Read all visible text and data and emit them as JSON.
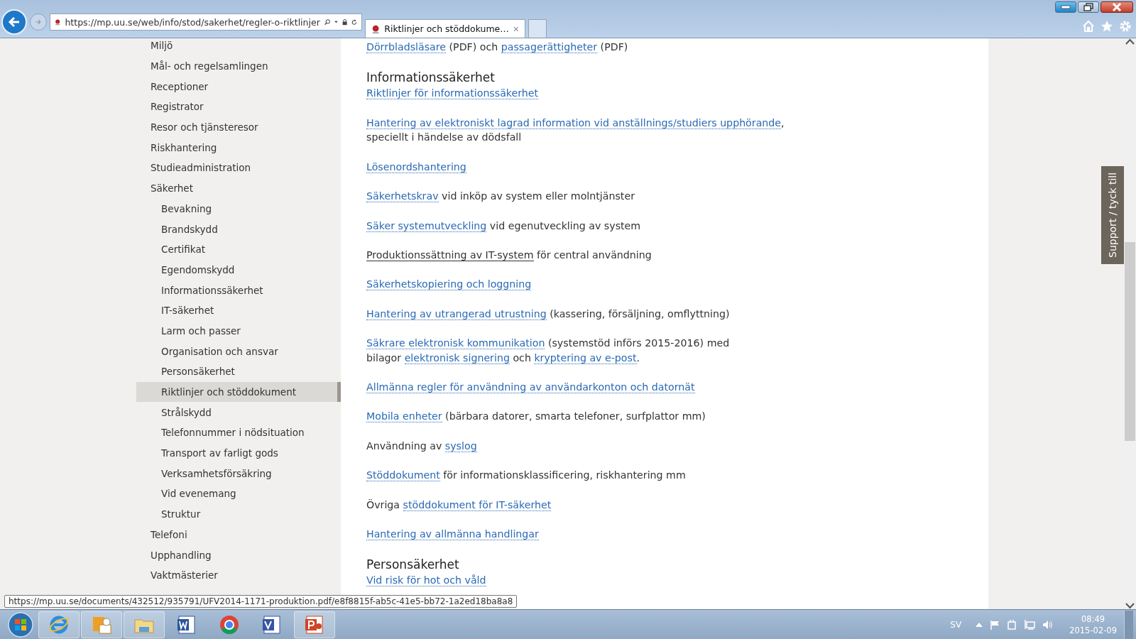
{
  "browser": {
    "address": "https://mp.uu.se/web/info/stod/sakerhet/regler-o-riktlinjer",
    "tab_title": "Riktlinjer och stöddokume…",
    "tab_close": "×"
  },
  "sidebar": {
    "items": [
      {
        "label": "Miljö",
        "selected": false
      },
      {
        "label": "Mål- och regelsamlingen",
        "selected": false
      },
      {
        "label": "Receptioner",
        "selected": false
      },
      {
        "label": "Registrator",
        "selected": false
      },
      {
        "label": "Resor och tjänsteresor",
        "selected": false
      },
      {
        "label": "Riskhantering",
        "selected": false
      },
      {
        "label": "Studieadministration",
        "selected": false
      },
      {
        "label": "Säkerhet",
        "selected": false,
        "children": [
          {
            "label": "Bevakning",
            "selected": false
          },
          {
            "label": "Brandskydd",
            "selected": false
          },
          {
            "label": "Certifikat",
            "selected": false
          },
          {
            "label": "Egendomskydd",
            "selected": false
          },
          {
            "label": "Informationssäkerhet",
            "selected": false
          },
          {
            "label": "IT-säkerhet",
            "selected": false
          },
          {
            "label": "Larm och passer",
            "selected": false
          },
          {
            "label": "Organisation och ansvar",
            "selected": false
          },
          {
            "label": "Personsäkerhet",
            "selected": false
          },
          {
            "label": "Riktlinjer och stöddokument",
            "selected": true
          },
          {
            "label": "Strålskydd",
            "selected": false
          },
          {
            "label": "Telefonnummer i nödsituation",
            "selected": false
          },
          {
            "label": "Transport av farligt gods",
            "selected": false
          },
          {
            "label": "Verksamhetsförsäkring",
            "selected": false
          },
          {
            "label": "Vid evenemang",
            "selected": false
          },
          {
            "label": "Struktur",
            "selected": false
          }
        ]
      },
      {
        "label": "Telefoni",
        "selected": false
      },
      {
        "label": "Upphandling",
        "selected": false
      },
      {
        "label": "Vaktmästerier",
        "selected": false
      }
    ]
  },
  "content": [
    {
      "kind": "paragraph",
      "lines": [
        [
          {
            "kind": "link",
            "text": "Dörrbladsläsare"
          },
          {
            "kind": "text",
            "text": " (PDF) och "
          },
          {
            "kind": "link",
            "text": "passagerättigheter"
          },
          {
            "kind": "text",
            "text": " (PDF)"
          }
        ]
      ]
    },
    {
      "kind": "heading",
      "text": "Informationssäkerhet"
    },
    {
      "kind": "paragraph",
      "lines": [
        [
          {
            "kind": "link",
            "text": "Riktlinjer för informationssäkerhet"
          }
        ]
      ]
    },
    {
      "kind": "paragraph",
      "lines": [
        [
          {
            "kind": "link",
            "text": "Hantering av elektroniskt lagrad information vid anställnings/studiers upphörande"
          },
          {
            "kind": "text",
            "text": ","
          }
        ],
        [
          {
            "kind": "text",
            "text": "speciellt i händelse av dödsfall"
          }
        ]
      ]
    },
    {
      "kind": "paragraph",
      "lines": [
        [
          {
            "kind": "link",
            "text": "Lösenordshantering"
          }
        ]
      ]
    },
    {
      "kind": "paragraph",
      "lines": [
        [
          {
            "kind": "link",
            "text": "Säkerhetskrav"
          },
          {
            "kind": "text",
            "text": " vid inköp av system eller molntjänster"
          }
        ]
      ]
    },
    {
      "kind": "paragraph",
      "lines": [
        [
          {
            "kind": "link",
            "text": "Säker systemutveckling"
          },
          {
            "kind": "text",
            "text": " vid egenutveckling av system"
          }
        ]
      ]
    },
    {
      "kind": "paragraph",
      "lines": [
        [
          {
            "kind": "hover-link",
            "text": "Produktionssättning av IT-system"
          },
          {
            "kind": "text",
            "text": " för central användning"
          }
        ]
      ]
    },
    {
      "kind": "paragraph",
      "lines": [
        [
          {
            "kind": "link",
            "text": "Säkerhetskopiering och loggning"
          }
        ]
      ]
    },
    {
      "kind": "paragraph",
      "lines": [
        [
          {
            "kind": "link",
            "text": "Hantering av utrangerad utrustning"
          },
          {
            "kind": "text",
            "text": " (kassering, försäljning, omflyttning)"
          }
        ]
      ]
    },
    {
      "kind": "paragraph",
      "lines": [
        [
          {
            "kind": "link",
            "text": "Säkrare elektronisk kommunikation"
          },
          {
            "kind": "text",
            "text": " (systemstöd införs 2015-2016) med"
          }
        ],
        [
          {
            "kind": "text",
            "text": "bilagor "
          },
          {
            "kind": "link",
            "text": "elektronisk signering"
          },
          {
            "kind": "text",
            "text": " och "
          },
          {
            "kind": "link",
            "text": "kryptering av e-post"
          },
          {
            "kind": "text",
            "text": "."
          }
        ]
      ]
    },
    {
      "kind": "paragraph",
      "lines": [
        [
          {
            "kind": "link",
            "text": "Allmänna regler för användning av användarkonton och datornät"
          }
        ]
      ]
    },
    {
      "kind": "paragraph",
      "lines": [
        [
          {
            "kind": "link",
            "text": "Mobila enheter"
          },
          {
            "kind": "text",
            "text": " (bärbara datorer, smarta telefoner, surfplattor mm)"
          }
        ]
      ]
    },
    {
      "kind": "paragraph",
      "lines": [
        [
          {
            "kind": "text",
            "text": "Användning av "
          },
          {
            "kind": "link",
            "text": "syslog"
          }
        ]
      ]
    },
    {
      "kind": "paragraph",
      "lines": [
        [
          {
            "kind": "link",
            "text": "Stöddokument"
          },
          {
            "kind": "text",
            "text": " för informationsklassificering, riskhantering mm"
          }
        ]
      ]
    },
    {
      "kind": "paragraph",
      "lines": [
        [
          {
            "kind": "text",
            "text": "Övriga "
          },
          {
            "kind": "link",
            "text": "stöddokument för IT-säkerhet"
          }
        ]
      ]
    },
    {
      "kind": "paragraph",
      "lines": [
        [
          {
            "kind": "link",
            "text": "Hantering av allmänna handlingar"
          }
        ]
      ]
    },
    {
      "kind": "heading",
      "text": "Personsäkerhet"
    },
    {
      "kind": "paragraph",
      "lines": [
        [
          {
            "kind": "link",
            "text": "Vid risk för hot och våld"
          }
        ]
      ]
    }
  ],
  "support_tab": "Support / tyck till",
  "status_tooltip": "https://mp.uu.se/documents/432512/935791/UFV2014-1171-produktion.pdf/e8f8815f-ab5c-41e5-bb72-1a2ed18ba8a8",
  "taskbar": {
    "language": "SV",
    "time": "08:49",
    "date": "2015-02-09"
  }
}
